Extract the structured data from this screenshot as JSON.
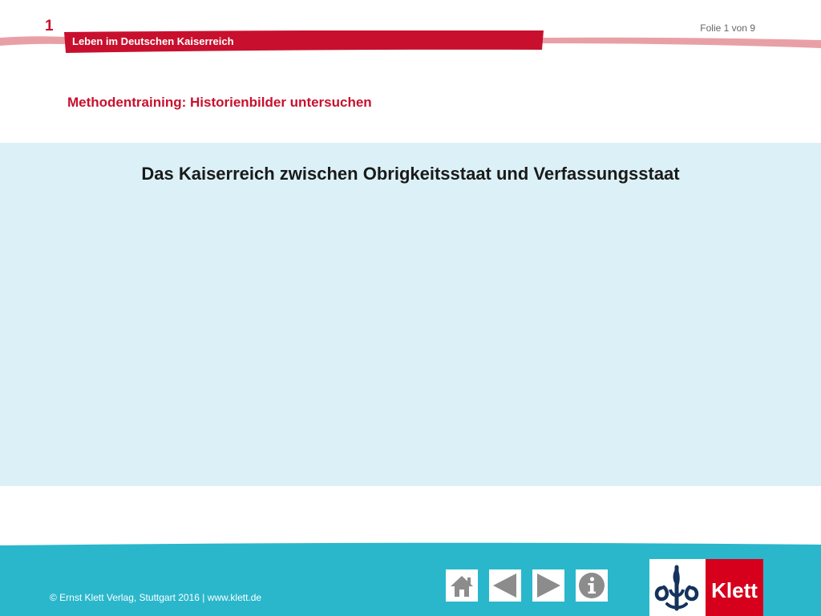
{
  "header": {
    "chapter_number": "1",
    "chapter_title": "Leben im Deutschen Kaiserreich",
    "slide_counter": "Folie 1 von 9"
  },
  "main": {
    "subtitle": "Methodentraining: Historienbilder untersuchen",
    "title": "Das Kaiserreich zwischen Obrigkeitsstaat und Verfassungsstaat"
  },
  "footer": {
    "copyright": "© Ernst Klett Verlag, Stuttgart 2016 | www.klett.de",
    "nav": [
      {
        "name": "home",
        "icon": "home-icon"
      },
      {
        "name": "previous",
        "icon": "arrow-left-icon"
      },
      {
        "name": "next",
        "icon": "arrow-right-icon"
      },
      {
        "name": "info",
        "icon": "info-icon"
      }
    ],
    "logo_text": "Klett"
  },
  "colors": {
    "accent_red": "#c8102e",
    "stripe_pale": "#e8a0a6",
    "content_bg": "#dcf1f7",
    "footer_teal": "#2ab7cc",
    "icon_gray": "#8c8c8c",
    "logo_red": "#d6001c"
  }
}
